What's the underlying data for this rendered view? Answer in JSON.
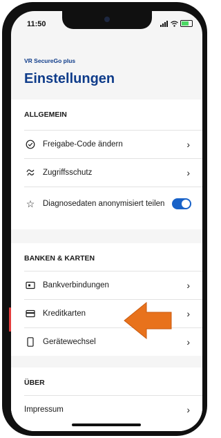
{
  "status_bar": {
    "time": "11:50"
  },
  "header": {
    "app_name": "VR SecureGo plus",
    "title": "Einstellungen"
  },
  "sections": {
    "allgemein": {
      "title": "ALLGEMEIN",
      "items": [
        {
          "label": "Freigabe-Code ändern",
          "icon": "check-circle-icon"
        },
        {
          "label": "Zugriffsschutz",
          "icon": "fingerprint-icon"
        },
        {
          "label": "Diagnosedaten anonymisiert teilen",
          "icon": "star-icon",
          "toggle_on": true
        }
      ]
    },
    "banken": {
      "title": "BANKEN & KARTEN",
      "items": [
        {
          "label": "Bankverbindungen",
          "icon": "bank-account-icon"
        },
        {
          "label": "Kreditkarten",
          "icon": "credit-card-icon"
        },
        {
          "label": "Gerätewechsel",
          "icon": "phone-icon"
        }
      ]
    },
    "ueber": {
      "title": "ÜBER",
      "items": [
        {
          "label": "Impressum"
        }
      ]
    }
  },
  "colors": {
    "brand_blue": "#0f3c8a",
    "toggle_blue": "#1862c8",
    "highlight_red": "#e23b3b",
    "arrow_orange": "#e8721c"
  }
}
